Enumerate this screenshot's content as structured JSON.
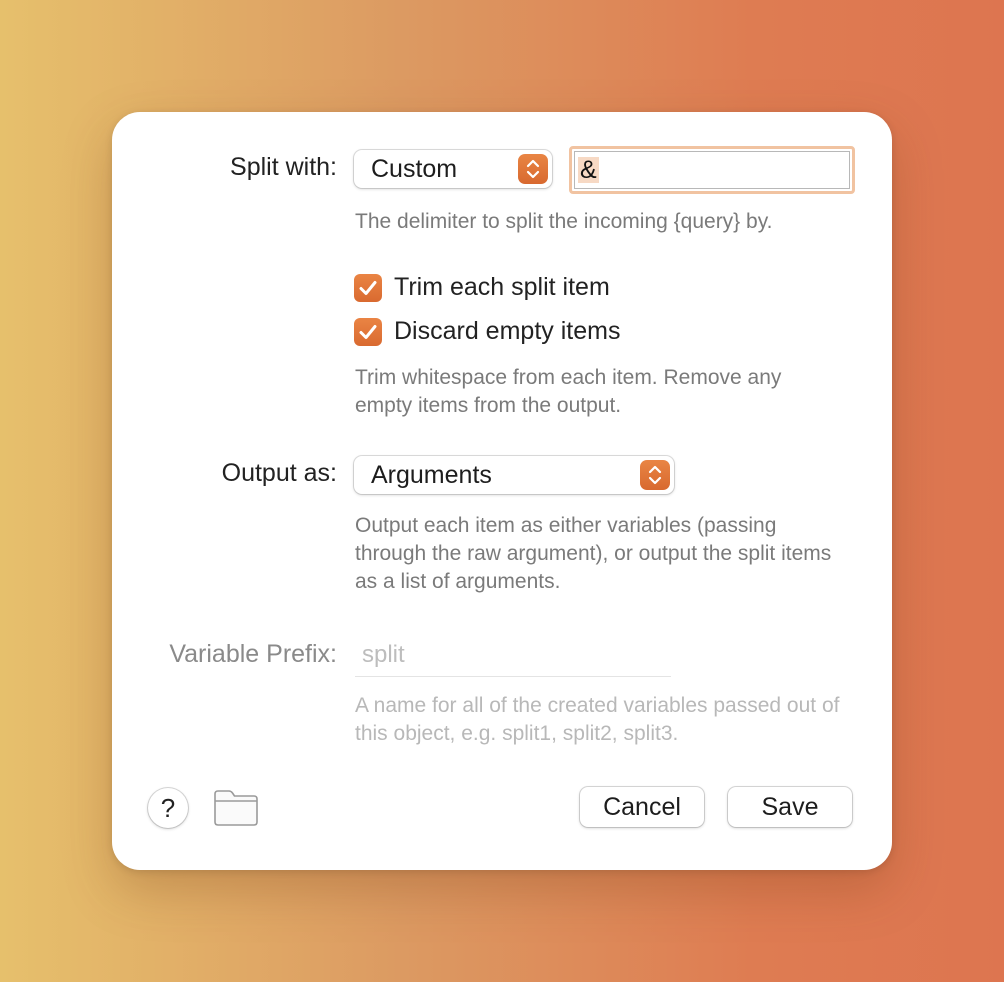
{
  "split": {
    "label": "Split with:",
    "selected": "Custom",
    "delimiter_value": "&",
    "help": "The delimiter to split the incoming {query} by."
  },
  "options": {
    "trim_label": "Trim each split item",
    "trim_checked": true,
    "discard_label": "Discard empty items",
    "discard_checked": true,
    "help": "Trim whitespace from each item. Remove any empty items from the output."
  },
  "output": {
    "label": "Output as:",
    "selected": "Arguments",
    "help": "Output each item as either variables (passing through the raw argument), or output the split items as a list of arguments."
  },
  "prefix": {
    "label": "Variable Prefix:",
    "placeholder": "split",
    "help": "A name for all of the created variables passed out of this object, e.g. split1, split2, split3."
  },
  "footer": {
    "help_label": "?",
    "cancel_label": "Cancel",
    "save_label": "Save"
  },
  "colors": {
    "accent": "#e07a3c"
  }
}
